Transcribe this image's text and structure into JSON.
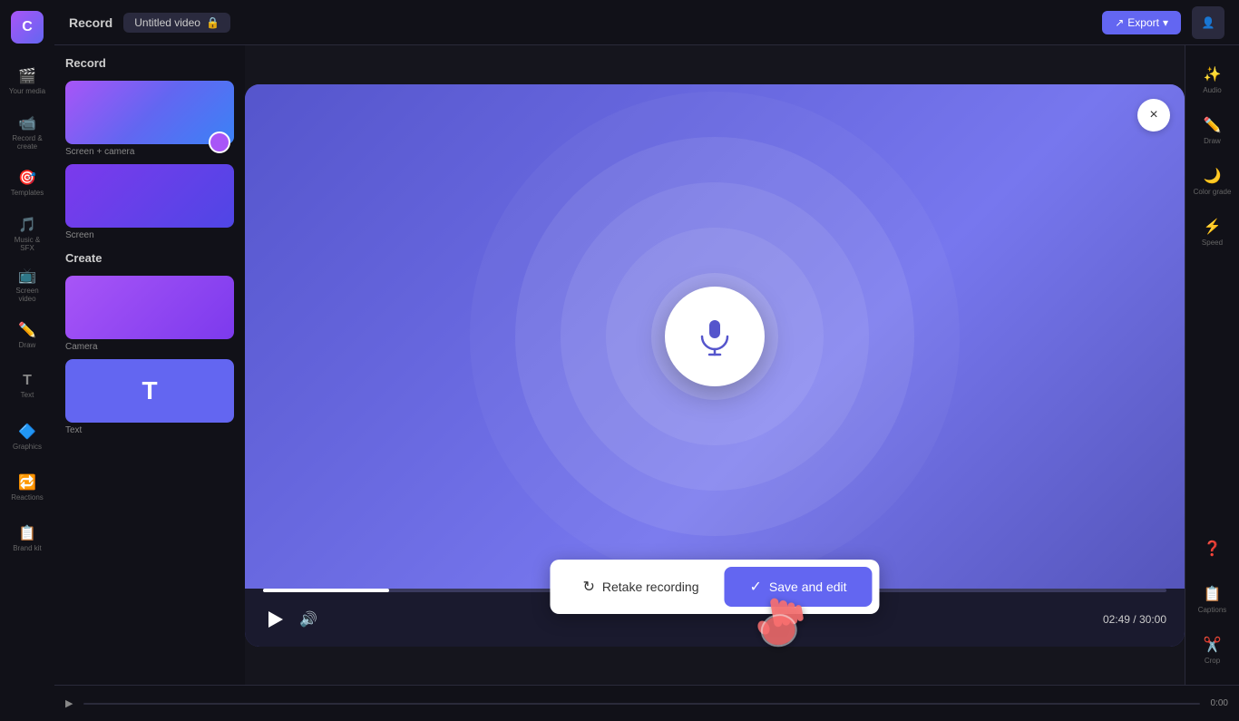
{
  "app": {
    "title": "Record",
    "tab": "Untitled video",
    "export_label": "Export"
  },
  "sidebar": {
    "items": [
      {
        "icon": "🎬",
        "label": "Your media"
      },
      {
        "icon": "📹",
        "label": "Record & create"
      },
      {
        "icon": "🎯",
        "label": "Templates"
      },
      {
        "icon": "🎵",
        "label": "Music & SFX"
      },
      {
        "icon": "📺",
        "label": "Screen video"
      },
      {
        "icon": "✏️",
        "label": "Draw"
      },
      {
        "icon": "T",
        "label": "Text"
      },
      {
        "icon": "🔷",
        "label": "Graphics"
      },
      {
        "icon": "🔁",
        "label": "Reactions"
      },
      {
        "icon": "📋",
        "label": "Brand kit"
      }
    ]
  },
  "right_panel": {
    "items": [
      {
        "icon": "✨",
        "label": "Audio"
      },
      {
        "icon": "✏️",
        "label": "Draw"
      },
      {
        "icon": "🌙",
        "label": "Color grade"
      },
      {
        "icon": "⚡",
        "label": "Speed"
      },
      {
        "icon": "❓",
        "label": ""
      },
      {
        "icon": "📋",
        "label": "Captions"
      },
      {
        "icon": "✂️",
        "label": "Crop"
      }
    ]
  },
  "modal": {
    "close_label": "×",
    "play_time": "02:49",
    "total_time": "30:00",
    "time_display": "02:49 / 30:00",
    "progress_percent": 14
  },
  "actions": {
    "retake_label": "Retake recording",
    "retake_icon": "↻",
    "save_edit_label": "Save and edit",
    "save_icon": "✓"
  },
  "left_panel": {
    "title": "Record",
    "create_title": "Create",
    "thumbnails": [
      {
        "label": "Screen + camera"
      },
      {
        "label": "Screen"
      },
      {
        "label": "Camera"
      },
      {
        "label": "Text"
      }
    ]
  }
}
